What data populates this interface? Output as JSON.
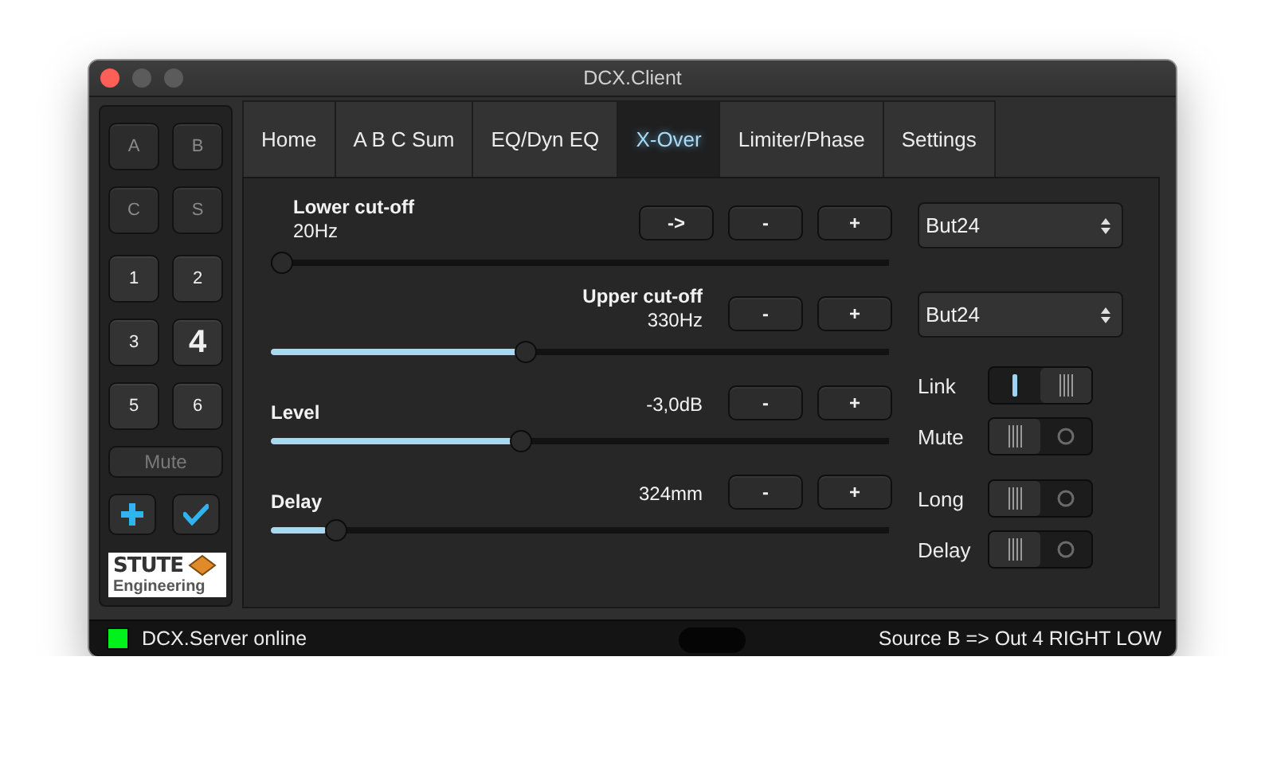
{
  "window": {
    "title": "DCX.Client"
  },
  "sidebar": {
    "buttons": [
      {
        "label": "A",
        "selected": false,
        "disabled": true
      },
      {
        "label": "B",
        "selected": false,
        "disabled": true
      },
      {
        "label": "C",
        "selected": false,
        "disabled": true
      },
      {
        "label": "S",
        "selected": false,
        "disabled": true
      },
      {
        "label": "1",
        "selected": false,
        "disabled": false
      },
      {
        "label": "2",
        "selected": false,
        "disabled": false
      },
      {
        "label": "3",
        "selected": false,
        "disabled": false
      },
      {
        "label": "4",
        "selected": true,
        "disabled": false
      },
      {
        "label": "5",
        "selected": false,
        "disabled": false
      },
      {
        "label": "6",
        "selected": false,
        "disabled": false
      }
    ],
    "mute": {
      "label": "Mute",
      "disabled": true
    },
    "logo": {
      "line_1": "STUTE",
      "line_2": "Engineering"
    }
  },
  "tabs": [
    {
      "label": "Home",
      "selected": false
    },
    {
      "label": "A B C Sum",
      "selected": false
    },
    {
      "label": "EQ/Dyn EQ",
      "selected": false
    },
    {
      "label": "X-Over",
      "selected": true
    },
    {
      "label": "Limiter/Phase",
      "selected": false
    },
    {
      "label": "Settings",
      "selected": false
    }
  ],
  "controls": [
    {
      "kind": "stacked-left",
      "label": "Lower cut-off",
      "value": "20Hz",
      "buttons": [
        "->",
        "-",
        "+"
      ],
      "level": 0
    },
    {
      "kind": "stacked-right",
      "label": "Upper cut-off",
      "value": "330Hz",
      "buttons": [
        "-",
        "+"
      ],
      "level": 0.41
    },
    {
      "kind": "split",
      "label": "Level",
      "value": "-3,0dB",
      "buttons": [
        "-",
        "+"
      ],
      "level": 0.4
    },
    {
      "kind": "split",
      "label": "Delay",
      "value": "324mm",
      "buttons": [
        "-",
        "+"
      ],
      "level": 0.09
    }
  ],
  "filters": [
    {
      "value": "But24"
    },
    {
      "value": "But24"
    }
  ],
  "toggle_groups": [
    [
      {
        "label": "Link",
        "on": true
      },
      {
        "label": "Mute",
        "on": false
      }
    ],
    [
      {
        "label": "Long",
        "on": false
      },
      {
        "label": "Delay",
        "on": false
      }
    ]
  ],
  "status_bar": {
    "online": true,
    "left": "DCX.Server online",
    "right": "Source B => Out 4 RIGHT LOW"
  }
}
